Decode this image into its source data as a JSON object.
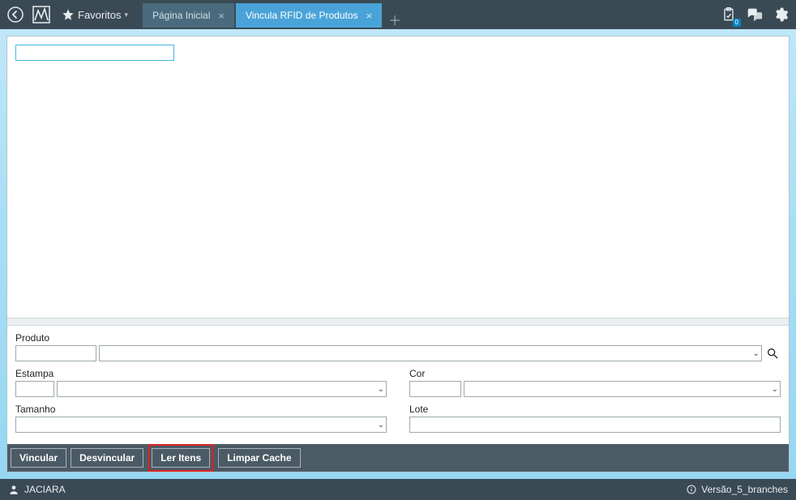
{
  "topbar": {
    "favoritos_label": "Favoritos",
    "clipboard_badge": "0"
  },
  "tabs": [
    {
      "label": "Página Inicial",
      "active": false
    },
    {
      "label": "Vincula RFID de Produtos",
      "active": true
    }
  ],
  "form": {
    "produto_label": "Produto",
    "estampa_label": "Estampa",
    "cor_label": "Cor",
    "tamanho_label": "Tamanho",
    "lote_label": "Lote",
    "produto_code": "",
    "produto_desc": "",
    "estampa_code": "",
    "estampa_desc": "",
    "cor_code": "",
    "cor_desc": "",
    "tamanho_value": "",
    "lote_value": ""
  },
  "buttons": {
    "vincular": "Vincular",
    "desvincular": "Desvincular",
    "ler_itens": "Ler Itens",
    "limpar_cache": "Limpar Cache"
  },
  "status": {
    "user": "JACIARA",
    "version": "Versão_5_branches"
  }
}
